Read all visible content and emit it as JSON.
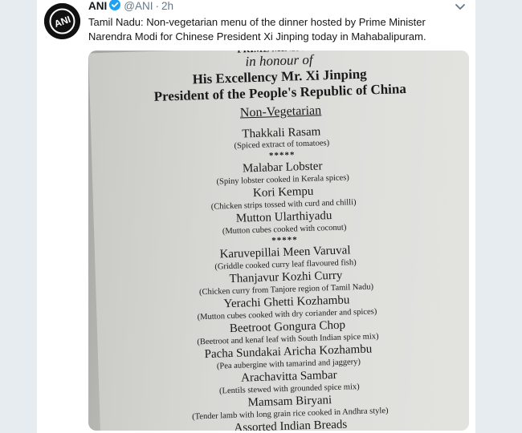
{
  "account": {
    "avatar_text": "ANI",
    "name": "ANI",
    "handle": "@ANI",
    "separator": "·",
    "time": "2h",
    "verified_color": "#1da1f2"
  },
  "icons": {
    "verified": "verified-badge-icon",
    "menu": "chevron-down-icon"
  },
  "tweet": {
    "text": "Tamil Nadu: Non-vegetarian menu of the dinner hosted by Prime Minister Narendra Modi for Chinese President Xi Jinping today in Mahabalipuram."
  },
  "menu_card": {
    "header_cut": "PRIME MINISTER",
    "honour": "in honour of",
    "dignitary_line1": "His Excellency Mr. Xi Jinping",
    "dignitary_line2": "President of the People's Republic of China",
    "section": "Non-Vegetarian",
    "separator": "*****",
    "items": [
      {
        "name": "Thakkali Rasam",
        "desc": "(Spiced extract of tomatoes)"
      },
      {
        "name": "Malabar Lobster",
        "desc": "(Spiny lobster cooked in Kerala spices)"
      },
      {
        "name": "Kori Kempu",
        "desc": "(Chicken strips tossed with curd and chilli)"
      },
      {
        "name": "Mutton Ularthiyadu",
        "desc": "(Mutton cubes cooked with coconut)"
      },
      {
        "name": "Karuvepillai Meen Varuval",
        "desc": "(Griddle cooked curry leaf flavoured fish)"
      },
      {
        "name": "Thanjavur Kozhi Curry",
        "desc": "(Chicken curry from Tanjore region of Tamil Nadu)"
      },
      {
        "name": "Yerachi Ghetti Kozhambu",
        "desc": "(Mutton cubes cooked with dry coriander and spices)"
      },
      {
        "name": "Beetroot Gongura Chop",
        "desc": "(Beetroot and kenaf leaf with South Indian spice mix)"
      },
      {
        "name": "Pacha Sundakai Aricha Kozhambu",
        "desc": "(Pea aubergine with tamarind and jaggery)"
      },
      {
        "name": "Arachavitta Sambar",
        "desc": "(Lentils stewed with grounded spice mix)"
      },
      {
        "name": "Mamsam Biryani",
        "desc": "(Tender lamb with long grain rice cooked in Andhra style)"
      },
      {
        "name": "Assorted Indian Breads",
        "desc": ""
      }
    ]
  }
}
